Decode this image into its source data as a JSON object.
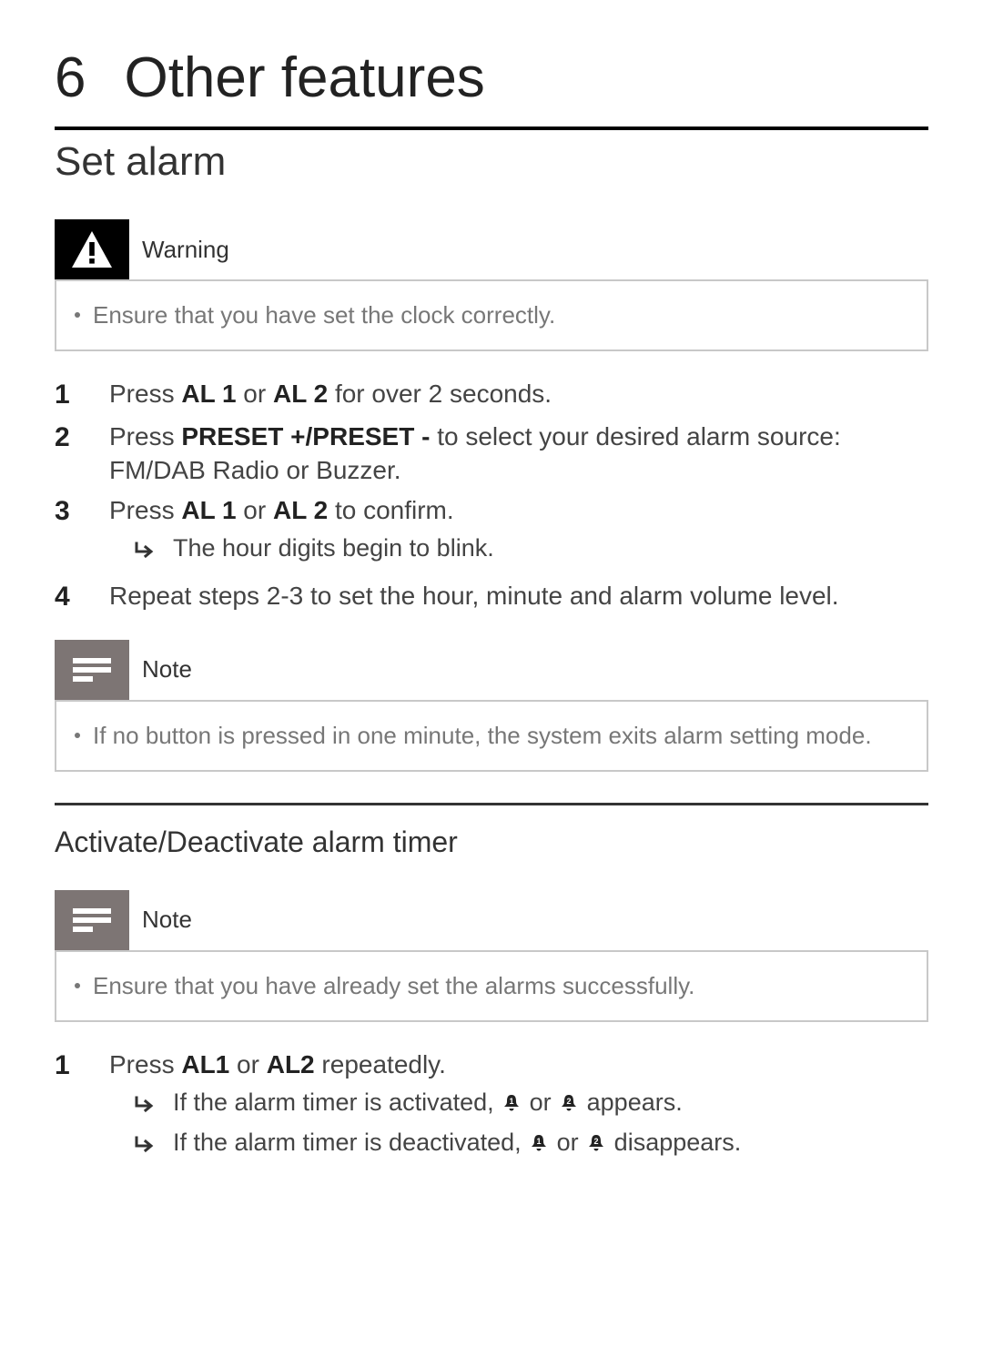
{
  "chapter": {
    "number": "6",
    "title": "Other features"
  },
  "section1": {
    "title": "Set alarm",
    "warning": {
      "label": "Warning",
      "body": "Ensure that you have set the clock correctly."
    },
    "steps": {
      "s1": {
        "num": "1",
        "pre": "Press ",
        "b1": "AL 1",
        "mid": " or ",
        "b2": "AL 2",
        "post": " for over 2 seconds."
      },
      "s2": {
        "num": "2",
        "pre": "Press ",
        "b1": "PRESET +/PRESET -",
        "post": " to select your desired alarm source: FM/DAB Radio or Buzzer."
      },
      "s3": {
        "num": "3",
        "pre": "Press ",
        "b1": "AL 1",
        "mid": " or ",
        "b2": "AL 2",
        "post": " to confirm.",
        "result": "The hour digits begin to blink."
      },
      "s4": {
        "num": "4",
        "text": "Repeat steps 2-3 to set the hour, minute and alarm volume level."
      }
    },
    "note": {
      "label": "Note",
      "body": "If no button is pressed in one minute, the system exits alarm setting mode."
    }
  },
  "section2": {
    "title": "Activate/Deactivate alarm timer",
    "note": {
      "label": "Note",
      "body": "Ensure that you have already set the alarms successfully."
    },
    "steps": {
      "s1": {
        "num": "1",
        "pre": "Press ",
        "b1": "AL1",
        "mid": " or ",
        "b2": "AL2",
        "post": " repeatedly.",
        "r1a": "If the alarm timer is activated, ",
        "r1b": " or ",
        "r1c": " appears.",
        "r2a": "If the alarm timer is deactivated, ",
        "r2b": " or ",
        "r2c": " disappears."
      }
    }
  }
}
